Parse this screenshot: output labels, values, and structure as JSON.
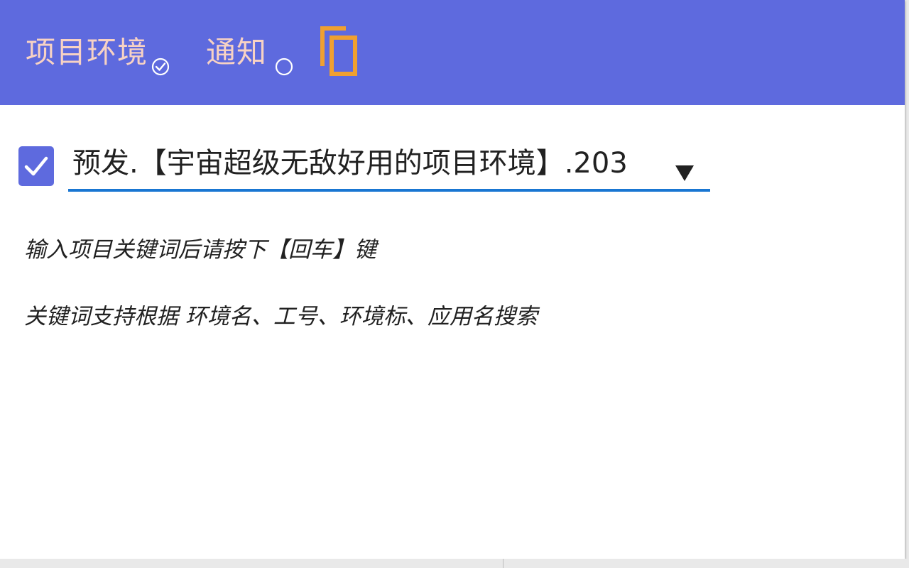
{
  "header": {
    "tabs": [
      {
        "label": "项目环境",
        "icon": "check-circle-icon"
      },
      {
        "label": "通知",
        "icon": "circle-outline-icon"
      }
    ],
    "copy_icon": "copy-icon"
  },
  "env_selector": {
    "checked": true,
    "value": "预发.【宇宙超级无敌好用的项目环境】.203",
    "dropdown_icon": "caret-down-icon"
  },
  "hints": [
    "输入项目关键词后请按下【回车】键",
    "关键词支持根据 环境名、工号、环境标、应用名搜索"
  ],
  "colors": {
    "header_bg": "#5e6ade",
    "tab_text": "#f7d2c4",
    "accent_orange": "#f0a030",
    "checkbox_bg": "#5e6ade",
    "underline": "#1976d2"
  }
}
